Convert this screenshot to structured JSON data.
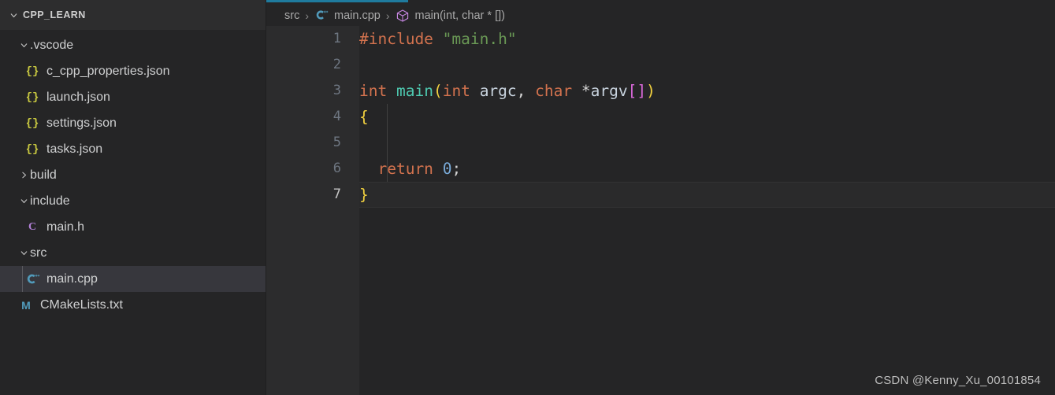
{
  "sidebar": {
    "header": {
      "title": "CPP_LEARN",
      "twisty": "chevron-down-icon"
    },
    "items": [
      {
        "label": ".vscode",
        "icon": "folder-open",
        "indent": 1,
        "twisty": "chevron-down",
        "selected": false
      },
      {
        "label": "c_cpp_properties.json",
        "icon": "json-icon",
        "indent": 2,
        "twisty": "",
        "selected": false,
        "glyph": "{}"
      },
      {
        "label": "launch.json",
        "icon": "json-icon",
        "indent": 2,
        "twisty": "",
        "selected": false,
        "glyph": "{}"
      },
      {
        "label": "settings.json",
        "icon": "json-icon",
        "indent": 2,
        "twisty": "",
        "selected": false,
        "glyph": "{}"
      },
      {
        "label": "tasks.json",
        "icon": "json-icon",
        "indent": 2,
        "twisty": "",
        "selected": false,
        "glyph": "{}"
      },
      {
        "label": "build",
        "icon": "folder",
        "indent": 1,
        "twisty": "chevron-right",
        "selected": false
      },
      {
        "label": "include",
        "icon": "folder-open",
        "indent": 1,
        "twisty": "chevron-down",
        "selected": false
      },
      {
        "label": "main.h",
        "icon": "c-header-icon",
        "indent": 2,
        "twisty": "",
        "selected": false,
        "glyph": "C"
      },
      {
        "label": "src",
        "icon": "folder-open",
        "indent": 1,
        "twisty": "chevron-down",
        "selected": false
      },
      {
        "label": "main.cpp",
        "icon": "cpp-icon",
        "indent": 2,
        "twisty": "",
        "selected": true
      },
      {
        "label": "CMakeLists.txt",
        "icon": "cmake-icon",
        "indent": 1,
        "twisty": "",
        "selected": false,
        "glyph": "M"
      }
    ]
  },
  "breadcrumb": {
    "parts": [
      {
        "text": "src",
        "icon": ""
      },
      {
        "text": "main.cpp",
        "icon": "cpp-icon"
      },
      {
        "text": "main(int, char * [])",
        "icon": "symbol-method-icon"
      }
    ],
    "separator": "›"
  },
  "editor": {
    "active_tab_accent": "#1f7b9e",
    "current_line": 7,
    "lines": [
      {
        "n": "1",
        "tokens": [
          {
            "t": "#include",
            "c": "t-pre"
          },
          {
            "t": " ",
            "c": "t-punc"
          },
          {
            "t": "\"main.h\"",
            "c": "t-str"
          }
        ]
      },
      {
        "n": "2",
        "tokens": []
      },
      {
        "n": "3",
        "tokens": [
          {
            "t": "int",
            "c": "t-type"
          },
          {
            "t": " ",
            "c": "t-punc"
          },
          {
            "t": "main",
            "c": "t-fn"
          },
          {
            "t": "(",
            "c": "t-p1"
          },
          {
            "t": "int",
            "c": "t-type"
          },
          {
            "t": " ",
            "c": "t-punc"
          },
          {
            "t": "argc",
            "c": "t-var"
          },
          {
            "t": ",",
            "c": "t-punc"
          },
          {
            "t": " ",
            "c": "t-punc"
          },
          {
            "t": "char",
            "c": "t-type"
          },
          {
            "t": " ",
            "c": "t-punc"
          },
          {
            "t": "*",
            "c": "t-punc"
          },
          {
            "t": "argv",
            "c": "t-var"
          },
          {
            "t": "[",
            "c": "t-p2"
          },
          {
            "t": "]",
            "c": "t-p2"
          },
          {
            "t": ")",
            "c": "t-p1"
          }
        ]
      },
      {
        "n": "4",
        "tokens": [
          {
            "t": "{",
            "c": "t-brace"
          }
        ]
      },
      {
        "n": "5",
        "tokens": []
      },
      {
        "n": "6",
        "tokens": [
          {
            "t": "  ",
            "c": "t-punc"
          },
          {
            "t": "return",
            "c": "t-kw"
          },
          {
            "t": " ",
            "c": "t-punc"
          },
          {
            "t": "0",
            "c": "t-num"
          },
          {
            "t": ";",
            "c": "t-punc"
          }
        ]
      },
      {
        "n": "7",
        "tokens": [
          {
            "t": "}",
            "c": "t-brace"
          }
        ]
      }
    ]
  },
  "watermark": {
    "text": "CSDN @Kenny_Xu_00101854"
  }
}
